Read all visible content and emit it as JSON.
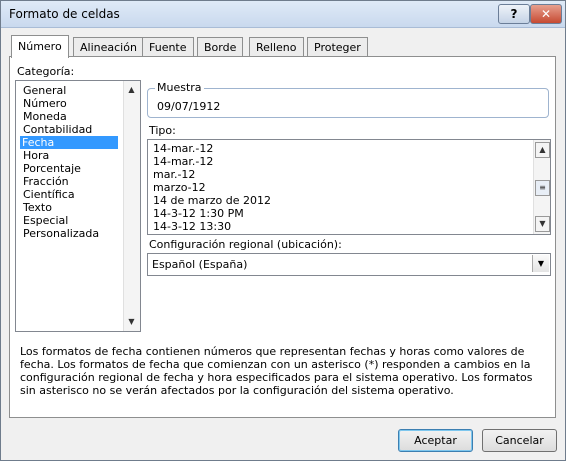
{
  "window": {
    "title": "Formato de celdas",
    "help_label": "?",
    "close_label": "✕"
  },
  "tabs": [
    {
      "label": "Número",
      "active": true
    },
    {
      "label": "Alineación",
      "active": false
    },
    {
      "label": "Fuente",
      "active": false
    },
    {
      "label": "Borde",
      "active": false
    },
    {
      "label": "Relleno",
      "active": false
    },
    {
      "label": "Proteger",
      "active": false
    }
  ],
  "categoria": {
    "label": "Categoría:",
    "items": [
      "General",
      "Número",
      "Moneda",
      "Contabilidad",
      "Fecha",
      "Hora",
      "Porcentaje",
      "Fracción",
      "Científica",
      "Texto",
      "Especial",
      "Personalizada"
    ],
    "selected": "Fecha"
  },
  "muestra": {
    "label": "Muestra",
    "value": "09/07/1912"
  },
  "tipo": {
    "label": "Tipo:",
    "items": [
      "14-mar.-12",
      "14-mar.-12",
      "mar.-12",
      "marzo-12",
      "14 de marzo de 2012",
      "14-3-12 1:30 PM",
      "14-3-12 13:30"
    ]
  },
  "config_regional": {
    "label": "Configuración regional (ubicación):",
    "value": "Español (España)"
  },
  "description": "Los formatos de fecha contienen números que representan fechas y horas como valores de fecha. Los formatos de fecha que comienzan con un asterisco (*) responden a cambios en la configuración regional de fecha y hora especificados para el sistema operativo. Los formatos sin asterisco no se verán afectados por la configuración del sistema operativo.",
  "buttons": {
    "accept": "Aceptar",
    "cancel": "Cancelar"
  },
  "colors": {
    "selection": "#3399ff",
    "titlebar": "#c9d9ee",
    "close_button": "#c64a32"
  },
  "icons": {
    "scroll_up": "▲",
    "scroll_down": "▼",
    "dropdown": "▼",
    "scroll_thumb": "≡"
  }
}
